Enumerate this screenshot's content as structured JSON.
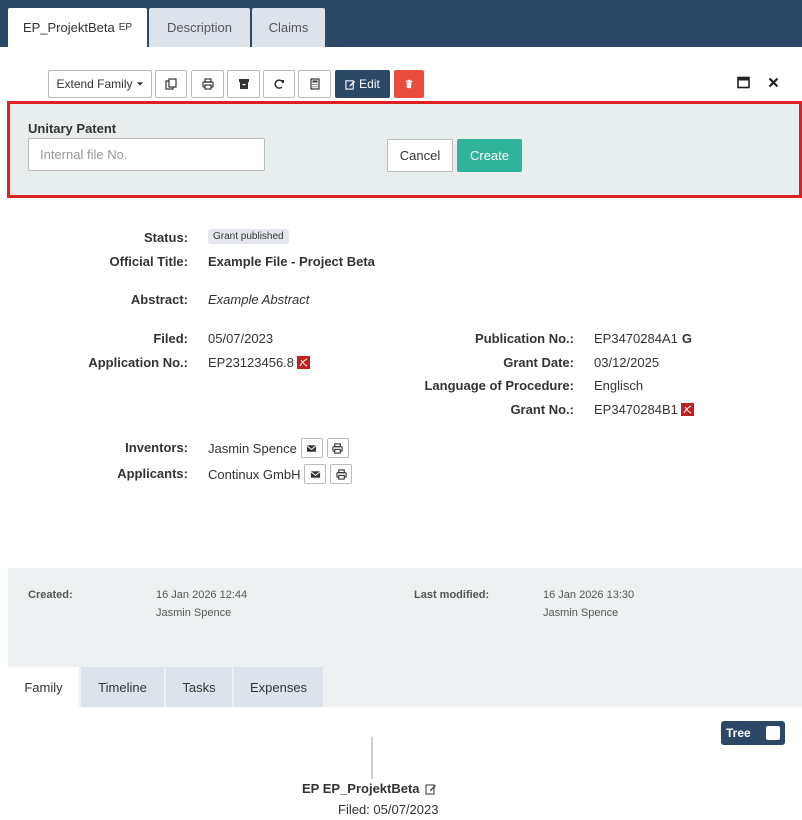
{
  "tabs": [
    {
      "label": "EP_ProjektBeta",
      "sub": "EP"
    },
    {
      "label": "Description"
    },
    {
      "label": "Claims"
    }
  ],
  "toolbar": {
    "extend_family_label": "Extend Family",
    "edit_label": "Edit"
  },
  "form": {
    "title": "Unitary Patent",
    "input_placeholder": "Internal file No.",
    "cancel_label": "Cancel",
    "create_label": "Create"
  },
  "details": {
    "status_label": "Status:",
    "status_value": "Grant published",
    "official_title_label": "Official Title:",
    "official_title_value": "Example File - Project Beta",
    "abstract_label": "Abstract:",
    "abstract_value": "Example Abstract",
    "filed_label": "Filed:",
    "filed_value": "05/07/2023",
    "application_no_label": "Application No.:",
    "application_no_value": "EP23123456.8",
    "publication_no_label": "Publication No.:",
    "publication_no_value": "EP3470284A1",
    "grant_date_label": "Grant Date:",
    "grant_date_value": "03/12/2025",
    "language_label": "Language of Procedure:",
    "language_value": "Englisch",
    "grant_no_label": "Grant No.:",
    "grant_no_value": "EP3470284B1",
    "inventors_label": "Inventors:",
    "inventors_value": "Jasmin Spence",
    "applicants_label": "Applicants:",
    "applicants_value": "Continux GmbH"
  },
  "meta": {
    "created_label": "Created:",
    "created_date": "16 Jan 2026 12:44",
    "created_by": "Jasmin Spence",
    "modified_label": "Last modified:",
    "modified_date": "16 Jan 2026 13:30",
    "modified_by": "Jasmin Spence"
  },
  "bottom_tabs": [
    {
      "label": "Family"
    },
    {
      "label": "Timeline"
    },
    {
      "label": "Tasks"
    },
    {
      "label": "Expenses"
    }
  ],
  "family": {
    "tree_toggle_label": "Tree",
    "node_title": "EP EP_ProjektBeta",
    "node_filed": "Filed: 05/07/2023"
  },
  "colors": {
    "header_bg": "#2b4867",
    "create_button": "#2fb39a",
    "delete_button": "#e74c3c",
    "highlight_border": "#e02020"
  }
}
